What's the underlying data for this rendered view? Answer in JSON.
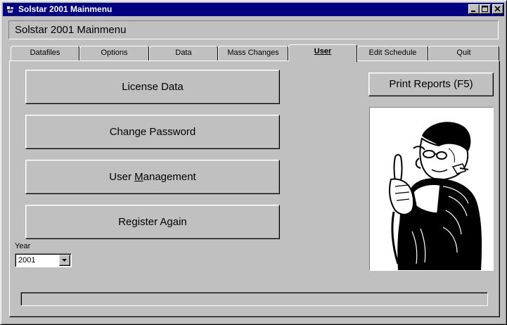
{
  "window": {
    "title": "Solstar 2001 Mainmenu"
  },
  "header": {
    "caption": "Solstar 2001 Mainmenu"
  },
  "tabs": [
    {
      "label": "Datafiles",
      "active": false
    },
    {
      "label": "Options",
      "active": false
    },
    {
      "label": "Data",
      "active": false
    },
    {
      "label": "Mass Changes",
      "active": false
    },
    {
      "label": "User",
      "active": true
    },
    {
      "label": "Edit Schedule",
      "active": false
    },
    {
      "label": "Quit",
      "active": false
    }
  ],
  "user_tab": {
    "license_label": "License Data",
    "change_password_label": "Change Password",
    "user_management": {
      "before": "User ",
      "mnemonic": "M",
      "after": "anagement"
    },
    "register_label": "Register Again",
    "print_reports_label": "Print Reports (F5)",
    "year_label": "Year",
    "year_value": "2001"
  },
  "status": {
    "progress_fraction": 0
  },
  "colors": {
    "face": "#c0c0c0",
    "titlebar": "#000080",
    "highlight": "#ffffff",
    "shadow": "#808080"
  },
  "icons": [
    "app-icon",
    "minimize-icon",
    "maximize-icon",
    "close-icon",
    "dropdown-arrow-icon"
  ]
}
